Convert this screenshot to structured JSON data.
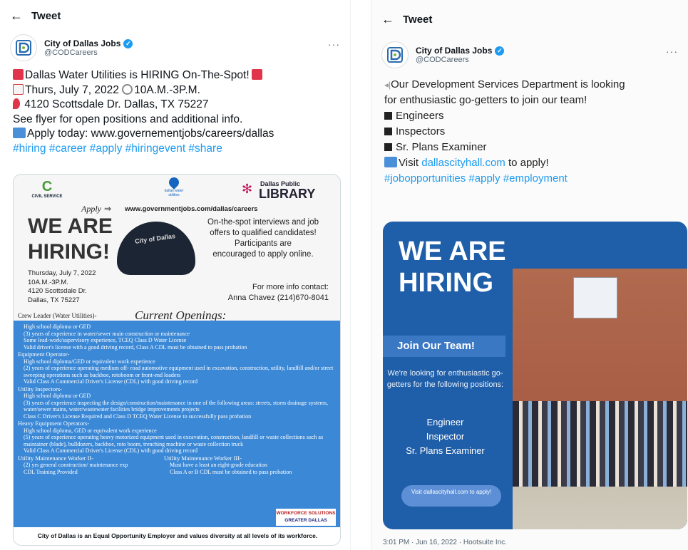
{
  "left": {
    "header_title": "Tweet",
    "author_name": "City of Dallas Jobs",
    "author_handle": "@CODCareers",
    "more": "···",
    "lines": [
      "Dallas Water Utilities is HIRING On-The-Spot!",
      "Thurs, July 7, 2022",
      "10A.M.-3P.M.",
      "4120 Scottsdale Dr. Dallas, TX 75227",
      "See flyer for open positions and additional info.",
      "Apply today:  www.governementjobs/careers/dallas"
    ],
    "hashtags": "#hiring #career #apply #hiringevent #share",
    "flyer": {
      "civil_service": "CIVIL SERVICE",
      "dwu": "dallas water utilities",
      "library_top": "Dallas Public",
      "library": "LIBRARY",
      "apply_word": "Apply",
      "apply_url": "www.governmentjobs.com/dallas/careers",
      "we_are": "WE ARE",
      "hiring": "HIRING!",
      "cap_text": "City of Dallas",
      "interviews_1": "On-the-spot interviews and job",
      "interviews_2": "offers to qualified candidates!",
      "interviews_3": "Participants are",
      "interviews_4": "encouraged to apply online.",
      "date": "Thursday, July 7, 2022",
      "time": "10A.M.-3P.M.",
      "street": "4120 Scottsdale Dr.",
      "city": "Dallas, TX 75227",
      "contact_1": "For more info contact:",
      "contact_2": "Anna Chavez (214)670-8041",
      "openings_title": "Current Openings:",
      "crew_leader": "Crew Leader (Water Utilities)-",
      "crew_items": [
        "High school diploma or GED",
        "(3) years of experience in water/sewer main construction or maintenance",
        "Some lead-work/supervisory experience, TCEQ Class D Water License",
        "Valid driver's license with a good driving record, Class A CDL must be obtained to pass probation"
      ],
      "equipment_op": "Equipment Operator-",
      "equipment_items": [
        "High school diploma/GED or equivalent work experience",
        "(2) years of experience operating medium off- road automotive equipment used in excavation, construction, utility, landfill and/or street sweeping operations such as backhoe, rotoboom or front-end loaders",
        "Valid Class A Commercial Driver's License (CDL) with good driving record"
      ],
      "utility_insp": "Utility Inspectors-",
      "insp_items": [
        "High school diploma or GED",
        "(3) years of experience inspecting the design/construction/maintenance in one of the following areas: streets, storm drainage systems, water/sewer mains, water/wastewater facilities bridge improvements projects",
        "Class C Driver's License Required and Class D TCEQ Water License to successfully pass probation"
      ],
      "heavy_op": "Heavy Equipment Operators-",
      "heavy_items": [
        "High school diploma, GED or equivalent work experience",
        "(5) years of experience operating heavy motorized equipment used in excavation, construction, landfill or waste collections such as maintainer (blade), bulldozers, backhoe, roto boom, trenching machine or waste collection truck",
        "Valid Class A Commercial Driver's License (CDL) with good driving record"
      ],
      "umw2": "Utility Maintenance Worker II-",
      "umw2_items": [
        "(2) yrs general construction/ maintenance exp",
        "CDL Training Provided"
      ],
      "umw3": "Utility Maintenance Worker III-",
      "umw3_items": [
        "Must have a least an eight-grade education",
        "Class A or B CDL must be obtained to pass probation"
      ],
      "workforce": "WORKFORCE SOLUTIONS",
      "greater_dallas": "GREATER DALLAS",
      "eeo": "City of Dallas is an Equal Opportunity Employer and values diversity at all levels of its workforce."
    }
  },
  "right": {
    "header_title": "Tweet",
    "author_name": "City of Dallas Jobs",
    "author_handle": "@CODCareers",
    "more": "···",
    "line1": "Our Development Services Department is looking",
    "line2": "for enthusiastic go-getters to join our team!",
    "items": [
      "Engineers",
      "Inspectors",
      "Sr. Plans Examiner"
    ],
    "visit_pre": "Visit ",
    "visit_link": "dallascityhall.com",
    "visit_post": " to apply!",
    "hashtags": "#jobopportunities #apply #employment",
    "img": {
      "we_are": "WE ARE",
      "hiring": "HIRING",
      "join": "Join Our Team!",
      "desc": "We're looking for enthusiastic go-getters for the following positions:",
      "pos1": "Engineer",
      "pos2": "Inspector",
      "pos3": "Sr. Plans Examiner",
      "visit": "Visit dallascityhall.com to apply!"
    },
    "timestamp": "3:01 PM · Jun 16, 2022 · Hootsuite Inc."
  },
  "colors": {
    "link": "#1d9bf0",
    "flyer_blue": "#3b88d6",
    "image_blue": "#1f5ea8"
  }
}
